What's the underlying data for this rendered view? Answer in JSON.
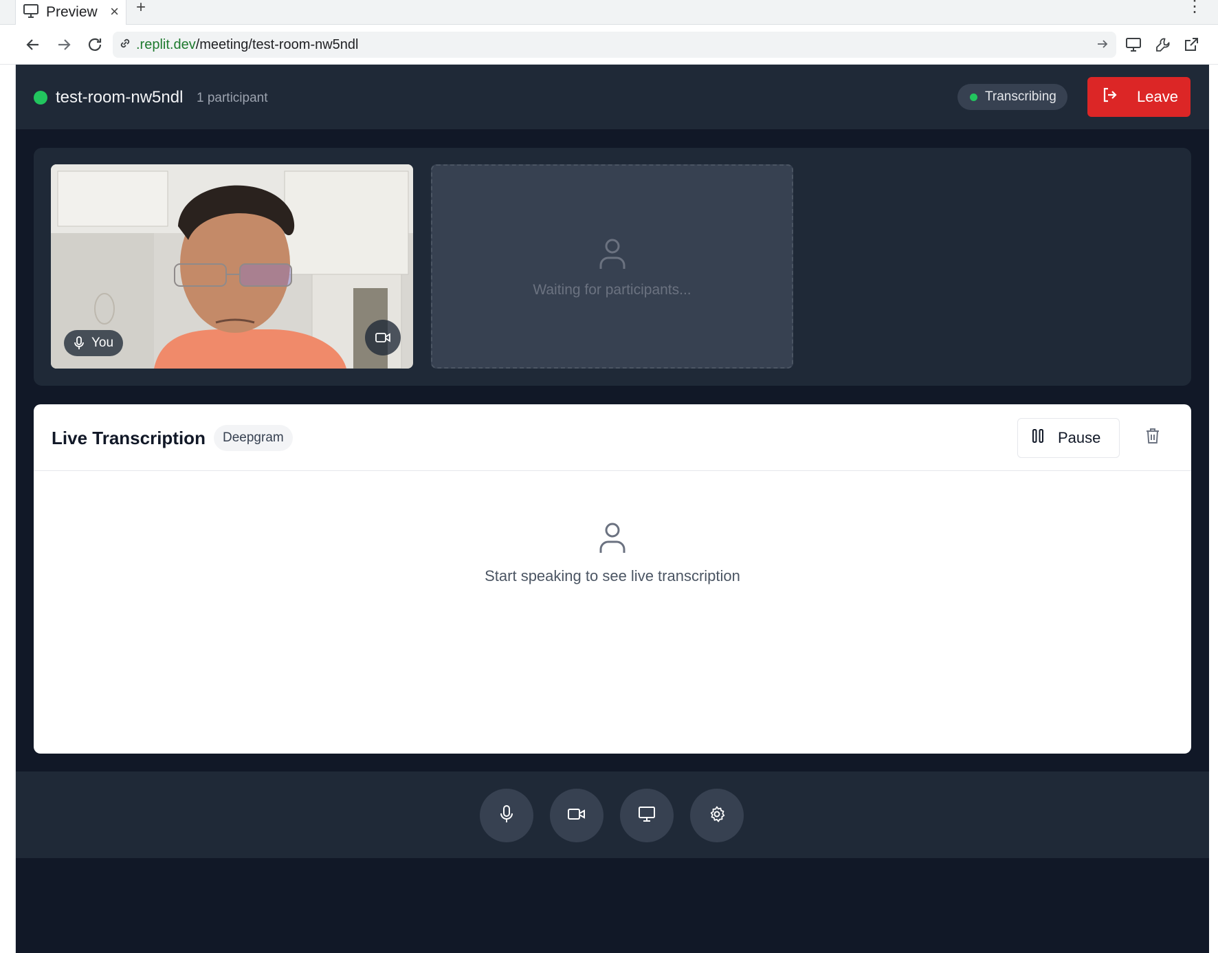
{
  "browser": {
    "tab_title": "Preview",
    "new_tab_symbol": "+",
    "close_symbol": "×",
    "menu_symbol": "⋮",
    "url_domain": ".replit.dev",
    "url_path": "/meeting/test-room-nw5ndl"
  },
  "meeting": {
    "room_name": "test-room-nw5ndl",
    "participant_count": "1 participant",
    "status_label": "Transcribing",
    "leave_label": "Leave",
    "self_label": "You",
    "waiting_text": "Waiting for participants..."
  },
  "transcription": {
    "title": "Live Transcription",
    "provider": "Deepgram",
    "pause_label": "Pause",
    "empty_text": "Start speaking to see live transcription"
  },
  "controls": [
    {
      "icon": "microphone-icon"
    },
    {
      "icon": "video-camera-icon"
    },
    {
      "icon": "screen-share-icon"
    },
    {
      "icon": "settings-gear-icon"
    }
  ],
  "colors": {
    "app_bg": "#111827",
    "panel_bg": "#1f2937",
    "accent_green": "#22c55e",
    "leave_red": "#dc2626"
  }
}
